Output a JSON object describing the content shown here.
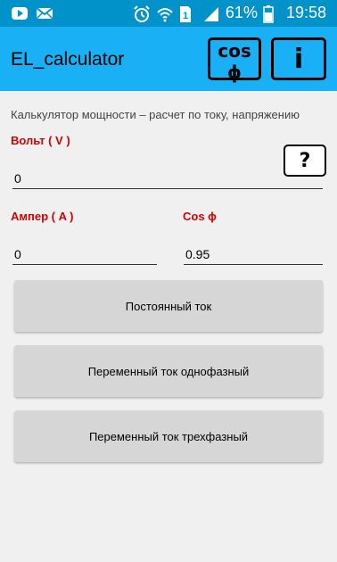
{
  "status_bar": {
    "battery": "61%",
    "time": "19:58",
    "notification_icons": [
      "youtube-icon",
      "mail-icon"
    ],
    "system_icons": [
      "alarm-icon",
      "wifi-icon",
      "sim-icon",
      "signal-icon",
      "battery-icon"
    ]
  },
  "app_bar": {
    "title": "EL_calculator",
    "cos_button_label": "cos ϕ",
    "info_button_label": "i",
    "color": "#1ab0f5"
  },
  "main": {
    "description": "Калькулятор мощности – расчет по току, напряжению",
    "voltage_label": "Вольт ( V )",
    "voltage_value": "0",
    "help_button_label": "?",
    "current_label": "Ампер ( A )",
    "current_value": "0",
    "cos_label": "Cos ϕ",
    "cos_value": "0.95",
    "label_color": "#d20000"
  },
  "actions": {
    "dc_label": "Постоянный ток",
    "ac_single_label": "Переменный ток однофазный",
    "ac_three_label": "Переменный ток трехфазный"
  }
}
